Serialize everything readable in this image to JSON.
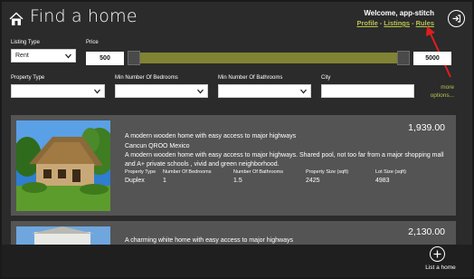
{
  "header": {
    "title": "Find a home",
    "welcome": "Welcome, app-stitch",
    "links": [
      "Profile",
      "Listings",
      "Rules"
    ],
    "link_separator": "-"
  },
  "filters": {
    "listing_type": {
      "label": "Listing Type",
      "value": "Rent"
    },
    "price": {
      "label": "Price",
      "min": "500",
      "max": "5000"
    },
    "property_type": {
      "label": "Property Type",
      "value": ""
    },
    "min_bedrooms": {
      "label": "Min Number Of Bedrooms",
      "value": ""
    },
    "min_bathrooms": {
      "label": "Min Number Of Bathrooms",
      "value": ""
    },
    "city": {
      "label": "City",
      "value": ""
    },
    "more_options": "more options..."
  },
  "listings": [
    {
      "price": "1,939.00",
      "title": "A modern wooden home with easy access to major highways",
      "location": "Cancun QROO Mexico",
      "description": "A modern wooden home with easy access to major highways. Shared pool, not too far from a major shopping mall and A+ private schools , vivid and green neighborhood.",
      "detail_headers": [
        "Property Type",
        "Number Of Bedrooms",
        "Number Of Bathrooms",
        "Property Size (sqft)",
        "Lot Size (sqft)"
      ],
      "detail_values": [
        "Duplex",
        "1",
        "1.5",
        "2425",
        "4983"
      ]
    },
    {
      "price": "2,130.00",
      "title": "A charming white home with easy access to major highways"
    }
  ],
  "appbar": {
    "add_label": "List a home"
  },
  "colors": {
    "accent": "#b7c24e",
    "slider": "#808234",
    "background": "#2b2b2b",
    "card": "#545454",
    "arrow": "#e11d1d"
  }
}
